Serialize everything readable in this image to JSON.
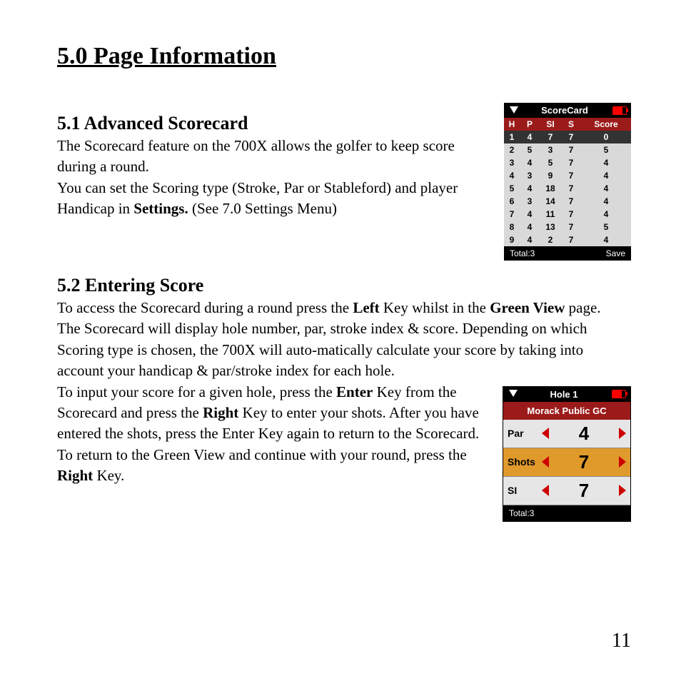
{
  "heading": "5.0 Page Information",
  "section1": {
    "title": "5.1 Advanced Scorecard",
    "para1a": "The Scorecard feature on the 700X allows the golfer to keep score during a round.",
    "para1b_pre": "You can set the Scoring type (Stroke, Par or Stableford) and player Handicap in ",
    "para1b_bold": "Settings.",
    "para1b_post": " (See 7.0 Settings Menu)"
  },
  "section2": {
    "title": "5.2 Entering Score",
    "p1_pre": "To access the Scorecard during a round press the ",
    "p1_b1": "Left",
    "p1_mid": " Key whilst in the ",
    "p1_b2": "Green View",
    "p1_post": " page.",
    "p2": "The Scorecard will display hole number, par, stroke index & score. Depending on which Scoring type is chosen, the 700X will auto-matically calculate your score by taking into account your handicap & par/stroke index for each hole.",
    "p3_pre": "To input your score for a given hole, press the ",
    "p3_b1": "Enter",
    "p3_mid1": " Key from the Scorecard and press the ",
    "p3_b2": "Right",
    "p3_mid2": " Key to enter your shots.  After you have entered the shots, press the Enter Key again to return to the Scorecard.  To return to the Green View and continue with your round, press the ",
    "p3_b3": "Right",
    "p3_post": " Key."
  },
  "page_number": "11",
  "scorecard": {
    "title": "ScoreCard",
    "headers": {
      "h": "H",
      "p": "P",
      "si": "SI",
      "s": "S",
      "score": "Score"
    },
    "rows": [
      {
        "h": "1",
        "p": "4",
        "si": "7",
        "s": "7",
        "score": "0"
      },
      {
        "h": "2",
        "p": "5",
        "si": "3",
        "s": "7",
        "score": "5"
      },
      {
        "h": "3",
        "p": "4",
        "si": "5",
        "s": "7",
        "score": "4"
      },
      {
        "h": "4",
        "p": "3",
        "si": "9",
        "s": "7",
        "score": "4"
      },
      {
        "h": "5",
        "p": "4",
        "si": "18",
        "s": "7",
        "score": "4"
      },
      {
        "h": "6",
        "p": "3",
        "si": "14",
        "s": "7",
        "score": "4"
      },
      {
        "h": "7",
        "p": "4",
        "si": "11",
        "s": "7",
        "score": "4"
      },
      {
        "h": "8",
        "p": "4",
        "si": "13",
        "s": "7",
        "score": "5"
      },
      {
        "h": "9",
        "p": "4",
        "si": "2",
        "s": "7",
        "score": "4"
      }
    ],
    "footer_left": "Total:3",
    "footer_right": "Save"
  },
  "holebox": {
    "title": "Hole 1",
    "course": "Morack Public GC",
    "par_label": "Par",
    "par_value": "4",
    "shots_label": "Shots",
    "shots_value": "7",
    "si_label": "SI",
    "si_value": "7",
    "footer": "Total:3"
  }
}
